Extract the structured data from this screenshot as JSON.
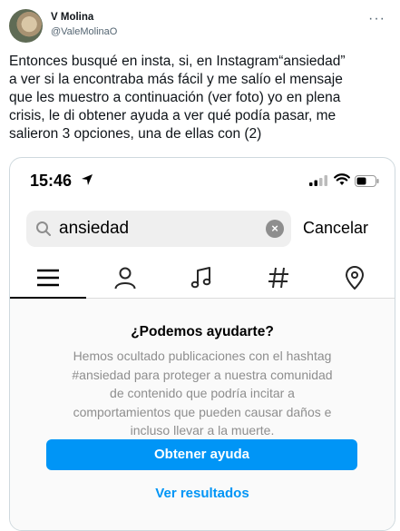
{
  "tweet": {
    "user_name": "V Molina",
    "user_handle": "@ValeMolinaO",
    "more_icon": "more-horizontal-icon",
    "text": "Entonces busqué en insta, si, en Instagram“ansiedad”\na ver si la encontraba más fácil y me salío el mensaje\nque les muestro a continuación (ver foto) yo en plena\ncrisis, le di obtener ayuda a ver qué podía pasar, me\nsalieron 3 opciones, una de ellas con (2)"
  },
  "phone": {
    "status": {
      "time": "15:46"
    },
    "search": {
      "value": "ansiedad",
      "cancel_label": "Cancelar"
    },
    "tabs": [
      {
        "icon": "menu-icon",
        "active": true
      },
      {
        "icon": "person-icon",
        "active": false
      },
      {
        "icon": "music-icon",
        "active": false
      },
      {
        "icon": "hashtag-icon",
        "active": false
      },
      {
        "icon": "location-icon",
        "active": false
      }
    ],
    "help": {
      "title": "¿Podemos ayudarte?",
      "body": "Hemos ocultado publicaciones con el hashtag\n#ansiedad para proteger a nuestra comunidad\nde contenido que podría incitar a\ncomportamientos que pueden causar daños e\nincluso llevar a la muerte.",
      "button_label": "Obtener ayuda",
      "link_label": "Ver resultados",
      "accent_color": "#0095f6"
    }
  }
}
